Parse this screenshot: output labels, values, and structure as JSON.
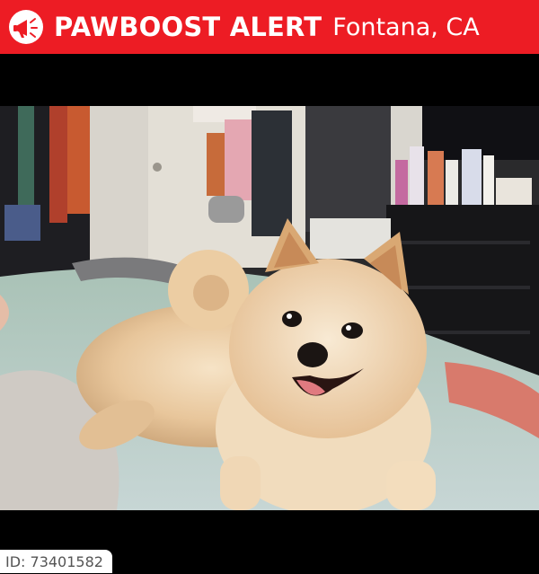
{
  "header": {
    "brand": "PAWBOOST ALERT",
    "location": "Fontana, CA",
    "background_color": "#ed1c24",
    "logo_icon": "megaphone-icon"
  },
  "photo": {
    "subject": "pomeranian-dog"
  },
  "footer": {
    "id_label": "ID: 73401582"
  }
}
